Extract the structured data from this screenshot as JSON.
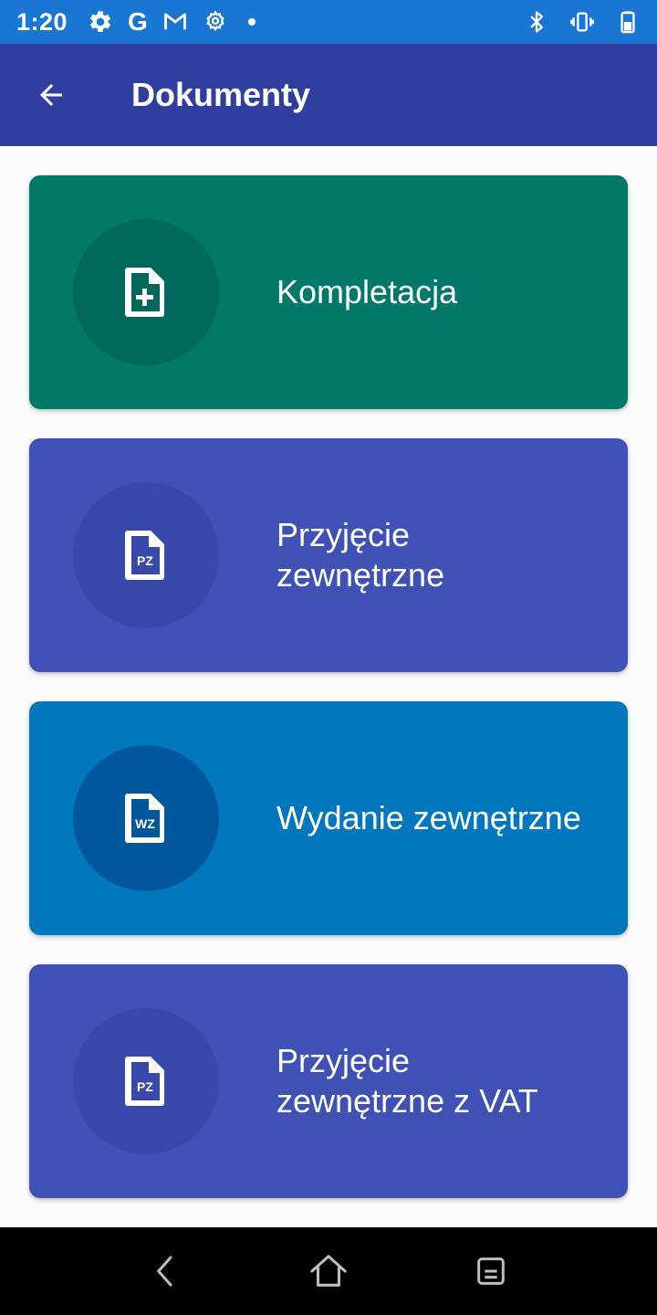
{
  "status_bar": {
    "time": "1:20",
    "g_letter": "G",
    "icons_left": [
      "gear-icon",
      "google-icon",
      "gmail-icon",
      "settings-icon",
      "notification-dot-icon"
    ],
    "icons_right": [
      "bluetooth-icon",
      "vibrate-icon",
      "battery-icon"
    ]
  },
  "app_bar": {
    "title": "Dokumenty",
    "back_icon": "arrow-left-icon"
  },
  "cards": [
    {
      "label": "Kompletacja",
      "icon": "document-plus-icon",
      "badge": "",
      "bg": "#00796b",
      "circle": "#00695c"
    },
    {
      "label": "Przyjęcie zewnętrzne",
      "icon": "document-pz-icon",
      "badge": "PZ",
      "bg": "#3f51b5",
      "circle": "#3949ab"
    },
    {
      "label": "Wydanie zewnętrzne",
      "icon": "document-wz-icon",
      "badge": "WZ",
      "bg": "#0277bd",
      "circle": "#01579b"
    },
    {
      "label": "Przyjęcie zewnętrzne z VAT",
      "icon": "document-pz-icon",
      "badge": "PZ",
      "bg": "#3f51b5",
      "circle": "#3949ab"
    }
  ],
  "colors": {
    "status_bar": "#1976d2",
    "app_bar": "#303f9f",
    "background": "#fafafa",
    "nav_bar": "#000000"
  },
  "nav_bar": {
    "icons": [
      "nav-back-icon",
      "nav-home-icon",
      "nav-recents-icon"
    ]
  }
}
